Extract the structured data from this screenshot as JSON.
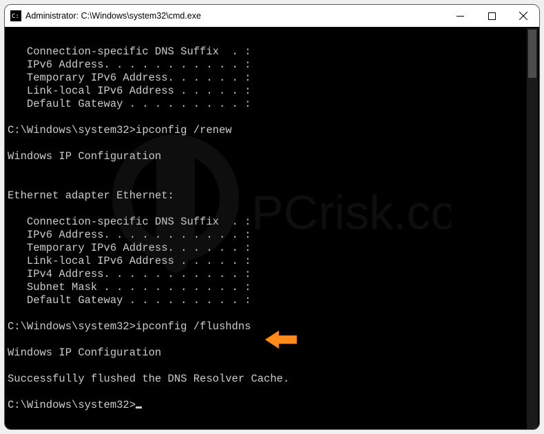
{
  "window": {
    "title": "Administrator: C:\\Windows\\system32\\cmd.exe"
  },
  "terminal": {
    "lines": [
      "",
      "   Connection-specific DNS Suffix  . :",
      "   IPv6 Address. . . . . . . . . . . :",
      "   Temporary IPv6 Address. . . . . . :",
      "   Link-local IPv6 Address . . . . . :",
      "   Default Gateway . . . . . . . . . :",
      "",
      "C:\\Windows\\system32>ipconfig /renew",
      "",
      "Windows IP Configuration",
      "",
      "",
      "Ethernet adapter Ethernet:",
      "",
      "   Connection-specific DNS Suffix  . :",
      "   IPv6 Address. . . . . . . . . . . :",
      "   Temporary IPv6 Address. . . . . . :",
      "   Link-local IPv6 Address . . . . . :",
      "   IPv4 Address. . . . . . . . . . . :",
      "   Subnet Mask . . . . . . . . . . . :",
      "   Default Gateway . . . . . . . . . :",
      "",
      "C:\\Windows\\system32>ipconfig /flushdns",
      "",
      "Windows IP Configuration",
      "",
      "Successfully flushed the DNS Resolver Cache.",
      "",
      "C:\\Windows\\system32>"
    ]
  },
  "annotation": {
    "arrow_color": "#ff8c1a"
  },
  "watermark": {
    "text": "PCrisk.com"
  }
}
